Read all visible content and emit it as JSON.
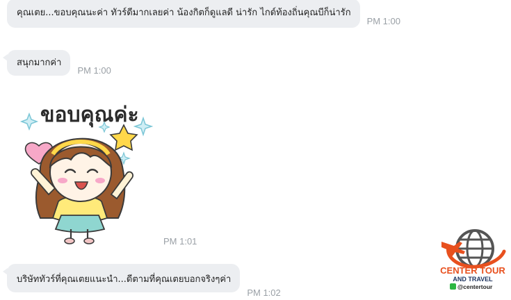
{
  "messages": [
    {
      "text": "คุณเตย...ขอบคุณนะค่า ทัวร์ดีมากเลยค่า น้องกิตก็ดูแลดี น่ารัก ไกด์ท้องถิ่นคุณบีก็น่ารัก",
      "time": "PM 1:00"
    },
    {
      "text": "สนุกมากค่า",
      "time": "PM 1:00"
    },
    {
      "sticker_text": "ขอบคุณค่ะ",
      "time": "PM 1:01"
    },
    {
      "text": "บริษัททัวร์ที่คุณเตยแนะนำ...ดีตามที่คุณเตยบอกจริงๆค่า",
      "time": "PM 1:02"
    }
  ],
  "watermark": {
    "line1": "CENTER TOUR",
    "line2": "AND TRAVEL",
    "handle": "@centertour",
    "colors": {
      "orange": "#e8501e",
      "navy": "#1f3560",
      "globe": "#555555"
    }
  }
}
